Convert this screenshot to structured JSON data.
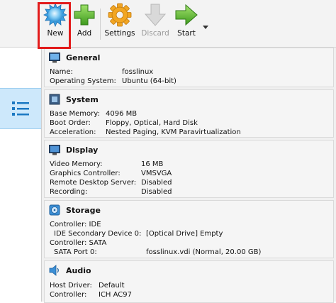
{
  "toolbar": {
    "new_label": "New",
    "add_label": "Add",
    "settings_label": "Settings",
    "discard_label": "Discard",
    "start_label": "Start"
  },
  "colors": {
    "highlight": "#e21b1b",
    "selected_tool": "#cde8fb"
  },
  "details": {
    "general": {
      "title": "General",
      "name_label": "Name:",
      "name_value": "fosslinux",
      "os_label": "Operating System:",
      "os_value": "Ubuntu (64-bit)"
    },
    "system": {
      "title": "System",
      "memory_label": "Base Memory:",
      "memory_value": "4096 MB",
      "boot_label": "Boot Order:",
      "boot_value": "Floppy, Optical, Hard Disk",
      "accel_label": "Acceleration:",
      "accel_value": "Nested Paging, KVM Paravirtualization"
    },
    "display": {
      "title": "Display",
      "vmem_label": "Video Memory:",
      "vmem_value": "16 MB",
      "gc_label": "Graphics Controller:",
      "gc_value": "VMSVGA",
      "rds_label": "Remote Desktop Server:",
      "rds_value": "Disabled",
      "rec_label": "Recording:",
      "rec_value": "Disabled"
    },
    "storage": {
      "title": "Storage",
      "ctrl_ide": "Controller: IDE",
      "ide_dev_label": "IDE Secondary Device 0:",
      "ide_dev_value": "[Optical Drive] Empty",
      "ctrl_sata": "Controller: SATA",
      "sata_port_label": "SATA Port 0:",
      "sata_port_value": "fosslinux.vdi (Normal, 20.00 GB)"
    },
    "audio": {
      "title": "Audio",
      "host_label": "Host Driver:",
      "host_value": "Default",
      "ctrl_label": "Controller:",
      "ctrl_value": "ICH AC97"
    }
  }
}
